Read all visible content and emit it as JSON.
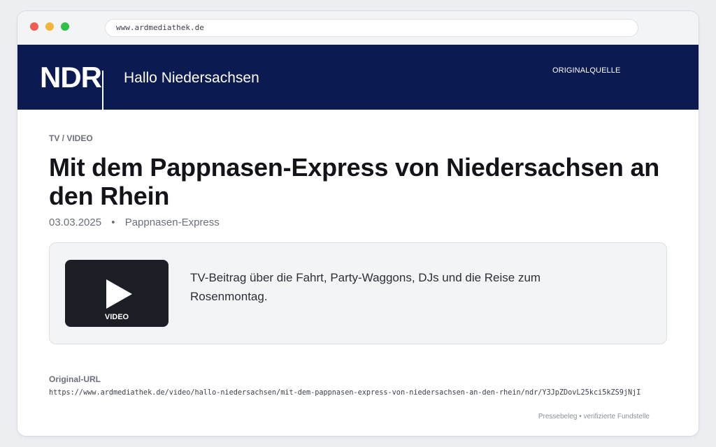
{
  "browser": {
    "address": "www.ardmediathek.de"
  },
  "header": {
    "logo": "NDR",
    "site_name": "Hallo Niedersachsen",
    "source_link": "ORIGINALQUELLE"
  },
  "article": {
    "section": "TV / VIDEO",
    "title": "Mit dem Pappnasen-Express von Niedersachsen an den Rhein",
    "date": "03.03.2025",
    "separator": "•",
    "category": "Pappnasen-Express"
  },
  "media_card": {
    "thumb_label": "VIDEO",
    "description": "TV-Beitrag über die Fahrt, Party-Waggons, DJs und die Reise zum Rosenmontag."
  },
  "source": {
    "label": "Original-URL",
    "url": "https://www.ardmediathek.de/video/hallo-niedersachsen/mit-dem-pappnasen-express-von-niedersachsen-an-den-rhein/ndr/Y3JpZDovL25kci5kZS9jNjI"
  },
  "footer": {
    "note": "Pressebeleg • verifizierte Fundstelle"
  },
  "colors": {
    "header_bg": "#0c1a52",
    "page_bg": "#eceef2",
    "thumb_bg": "#1b1e25"
  }
}
